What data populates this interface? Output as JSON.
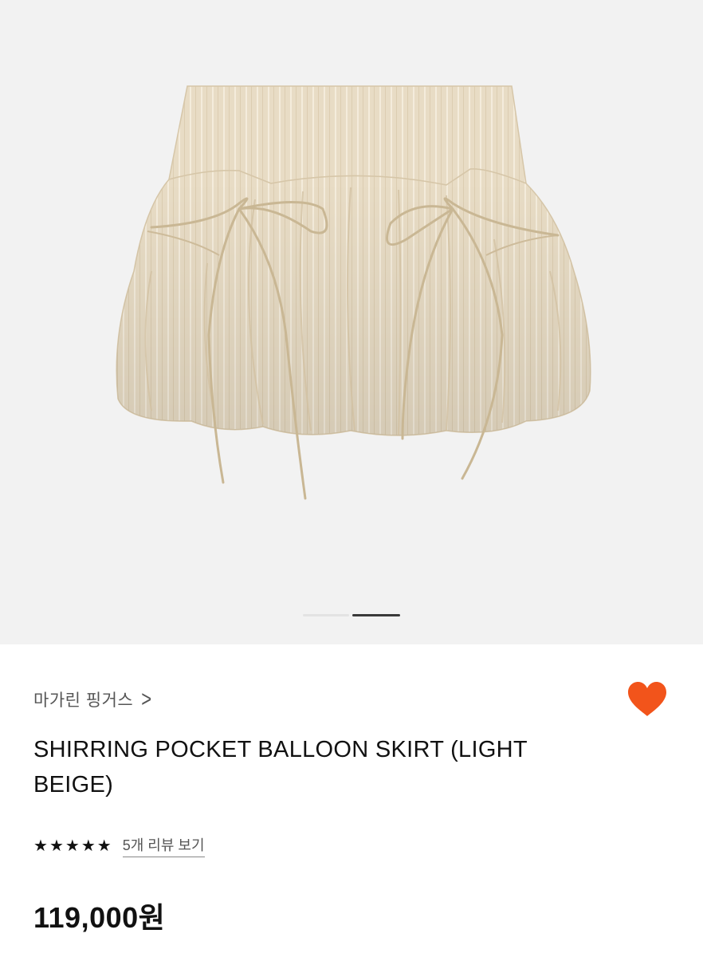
{
  "gallery": {
    "image_alt": "light beige striped shirring balloon mini skirt with bow ties",
    "fabric_color": "#e6dac2",
    "indicator_count": 2,
    "active_index": 1
  },
  "product": {
    "brand": "마가린 핑거스",
    "brand_chevron": ">",
    "title": "SHIRRING POCKET BALLOON SKIRT (LIGHT BEIGE)",
    "rating_stars": 5,
    "star_glyph": "★",
    "review_link": "5개 리뷰 보기",
    "price": "119,000원"
  },
  "icons": {
    "wishlist": "heart-icon",
    "wishlist_color": "#f2541b",
    "brand_link": "chevron-right-icon",
    "rating": "star-icon"
  }
}
